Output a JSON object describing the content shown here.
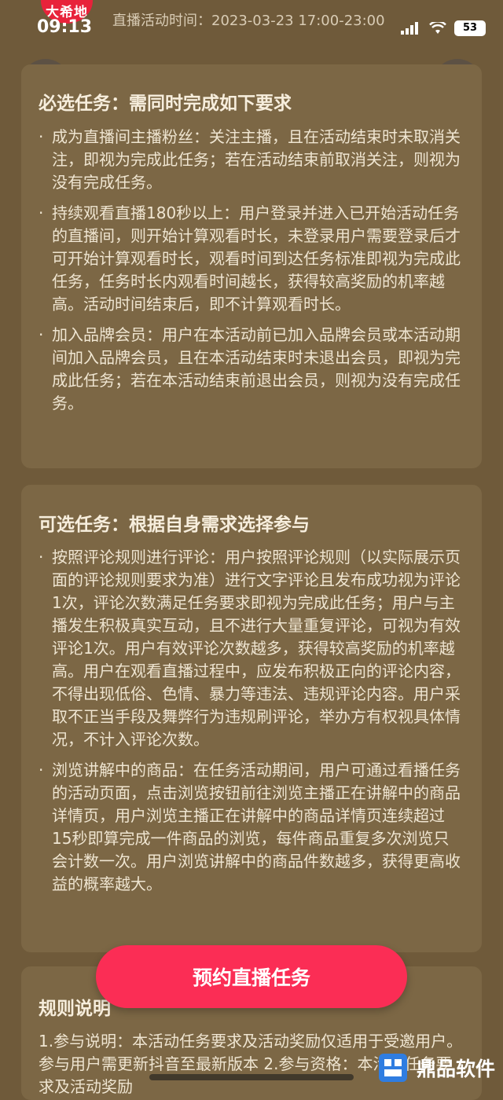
{
  "status_bar": {
    "brand_badge": "大希地",
    "time": "09:13",
    "activity_time": "直播活动时间：2023-03-23 17:00-23:00",
    "battery": "53"
  },
  "nav": {
    "back_icon": "chevron-left-icon",
    "share_icon": "share-arrow-icon"
  },
  "required_tasks": {
    "title": "必选任务：需同时完成如下要求",
    "items": [
      "成为直播间主播粉丝：关注主播，且在活动结束时未取消关注，即视为完成此任务；若在活动结束前取消关注，则视为没有完成任务。",
      "持续观看直播180秒以上：用户登录并进入已开始活动任务的直播间，则开始计算观看时长，未登录用户需要登录后才可开始计算观看时长，观看时间到达任务标准即视为完成此任务，任务时长内观看时间越长，获得较高奖励的机率越高。活动时间结束后，即不计算观看时长。",
      "加入品牌会员：用户在本活动前已加入品牌会员或本活动期间加入品牌会员，且在本活动结束时未退出会员，即视为完成此任务；若在本活动结束前退出会员，则视为没有完成任务。"
    ]
  },
  "optional_tasks": {
    "title": "可选任务：根据自身需求选择参与",
    "items": [
      "按照评论规则进行评论：用户按照评论规则（以实际展示页面的评论规则要求为准）进行文字评论且发布成功视为评论1次，评论次数满足任务要求即视为完成此任务；用户与主播发生积极真实互动，且不进行大量重复评论，可视为有效评论1次。用户有效评论次数越多，获得较高奖励的机率越高。用户在观看直播过程中，应发布积极正向的评论内容，不得出现低俗、色情、暴力等违法、违规评论内容。用户采取不正当手段及舞弊行为违规刷评论，举办方有权视具体情况，不计入评论次数。",
      "浏览讲解中的商品：在任务活动期间，用户可通过看播任务的活动页面，点击浏览按钮前往浏览主播正在讲解中的商品详情页，用户浏览主播正在讲解中的商品详情页连续超过15秒即算完成一件商品的浏览，每件商品重复多次浏览只会计数一次。用户浏览讲解中的商品件数越多，获得更高收益的概率越大。"
    ]
  },
  "rules": {
    "title": "规则说明",
    "text": "1.参与说明：本活动任务要求及活动奖励仅适用于受邀用户。参与用户需更新抖音至最新版本 2.参与资格：本活动任务要求及活动奖励"
  },
  "cta": {
    "label": "预约直播任务"
  },
  "watermark": {
    "text": "鼎品软件"
  },
  "colors": {
    "background": "#6f5a3a",
    "card": "#7c6745",
    "cta": "#fb2d55",
    "badge": "#e8223a"
  }
}
